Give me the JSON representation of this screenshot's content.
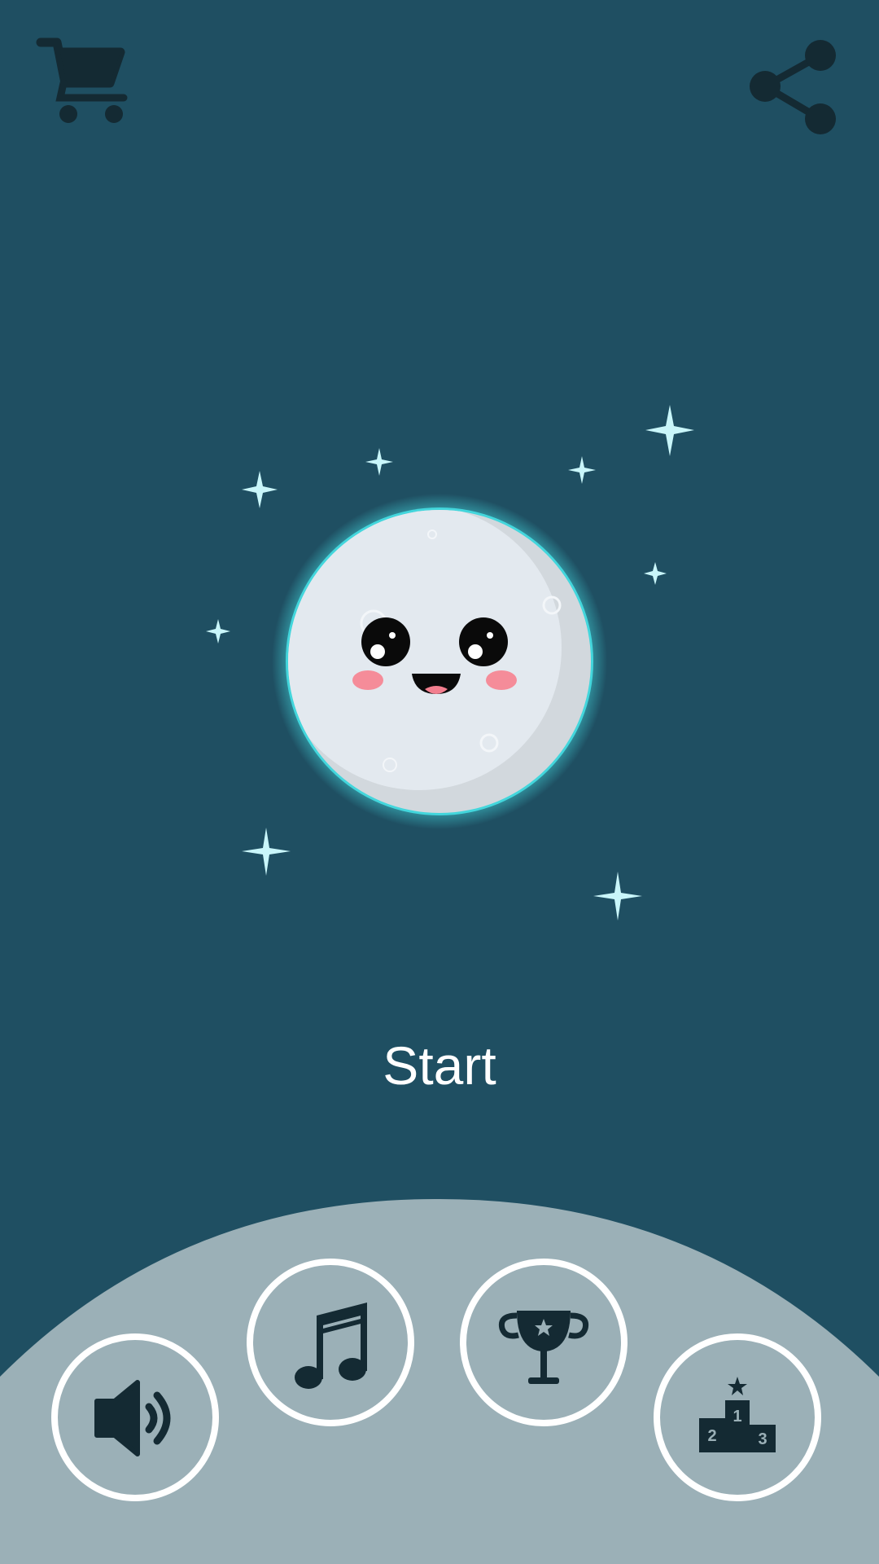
{
  "menu": {
    "start_label": "Start"
  },
  "icons": {
    "cart": "shopping-cart-icon",
    "share": "share-icon",
    "sound": "speaker-icon",
    "music": "music-note-icon",
    "achievements": "trophy-icon",
    "leaderboard": "podium-icon"
  },
  "podium": {
    "first": "1",
    "second": "2",
    "third": "3"
  },
  "colors": {
    "background": "#1f4f62",
    "hill": "#9bb0b7",
    "icon_dark": "#142a33",
    "moon": "#e3e9ef",
    "moon_glow": "#43d6dc",
    "star": "#c9f6fa"
  }
}
